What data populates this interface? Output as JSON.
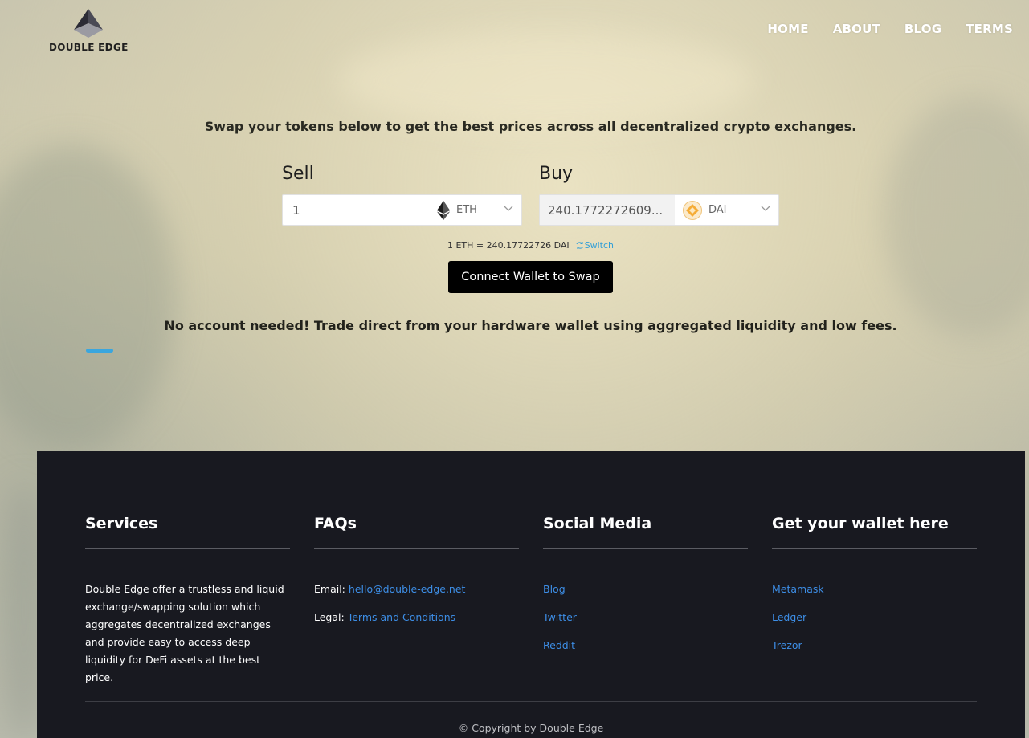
{
  "brand": {
    "name": "DOUBLE EDGE"
  },
  "nav": {
    "items": [
      "HOME",
      "ABOUT",
      "BLOG",
      "TERMS"
    ]
  },
  "swap": {
    "tagline": "Swap your tokens below to get the best prices across all decentralized crypto exchanges.",
    "sell_label": "Sell",
    "buy_label": "Buy",
    "sell_amount": "1",
    "sell_token": "ETH",
    "sell_token_icon": "ethereum-icon",
    "buy_amount": "240.1772272609...",
    "buy_token": "DAI",
    "buy_token_icon": "dai-icon",
    "rate": "1 ETH = 240.17722726 DAI",
    "switch_label": "Switch",
    "connect_button": "Connect Wallet to Swap",
    "subtagline": "No account needed! Trade direct from your hardware wallet using aggregated liquidity and low fees."
  },
  "footer": {
    "services": {
      "title": "Services",
      "text": "Double Edge offer a trustless and liquid exchange/swapping solution which aggregates decentralized exchanges and provide easy to access deep liquidity for DeFi assets at the best price."
    },
    "faqs": {
      "title": "FAQs",
      "email_label": "Email:",
      "email": "hello@double-edge.net",
      "legal_label": "Legal:",
      "legal_link": "Terms and Conditions"
    },
    "social": {
      "title": "Social Media",
      "links": [
        "Blog",
        "Twitter",
        "Reddit"
      ]
    },
    "wallets": {
      "title": "Get your wallet here",
      "links": [
        "Metamask",
        "Ledger",
        "Trezor"
      ]
    },
    "copyright": "© Copyright by Double Edge"
  },
  "colors": {
    "accent": "#3aa6de",
    "link": "#3d8ee6",
    "footer_bg": "#181920",
    "button_bg": "#000000"
  }
}
